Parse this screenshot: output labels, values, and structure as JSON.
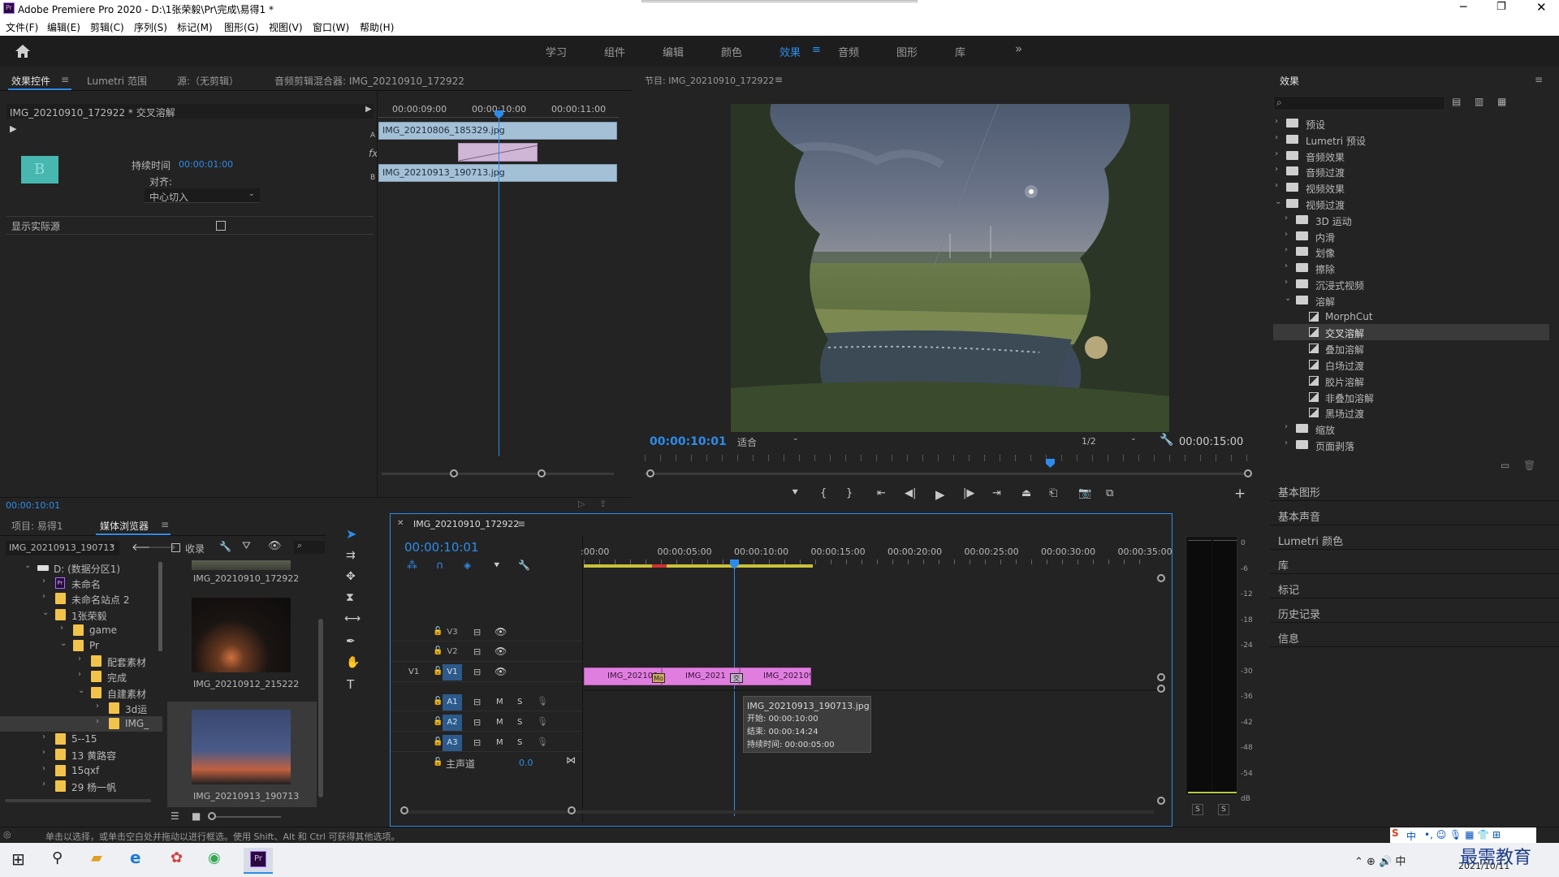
{
  "window": {
    "title": "Adobe Premiere Pro 2020 - D:\\1张荣毅\\Pr\\完成\\易得1 *"
  },
  "menu": [
    "文件(F)",
    "编辑(E)",
    "剪辑(C)",
    "序列(S)",
    "标记(M)",
    "图形(G)",
    "视图(V)",
    "窗口(W)",
    "帮助(H)"
  ],
  "workspaces": {
    "items": [
      "学习",
      "组件",
      "编辑",
      "颜色",
      "效果",
      "音频",
      "图形",
      "库"
    ],
    "active": "效果",
    "more": "»"
  },
  "effect_controls": {
    "tabs": [
      "效果控件",
      "Lumetri 范围",
      "源:（无剪辑）",
      "音频剪辑混合器: IMG_20210910_172922"
    ],
    "clip_title": "IMG_20210910_172922 * 交叉溶解",
    "duration_label": "持续时间",
    "duration_value": "00:00:01:00",
    "align_label": "对齐:",
    "align_value": "中心切入",
    "show_actual_label": "显示实际源",
    "ruler": [
      "00:00:09:00",
      "00:00:10:00",
      "00:00:11:00"
    ],
    "clip_a": "IMG_20210806_185329.jpg",
    "clip_b": "IMG_20210913_190713.jpg",
    "label_a": "A",
    "label_b": "B",
    "fx": "fx",
    "timecode": "00:00:10:01"
  },
  "program": {
    "title": "节目: IMG_20210910_172922",
    "timecode": "00:00:10:01",
    "fit": "适合",
    "quality": "1/2",
    "duration": "00:00:15:00"
  },
  "effects_panel": {
    "title": "效果",
    "search_placeholder": "",
    "tree": [
      {
        "label": "预设",
        "level": 0,
        "type": "folder",
        "open": false
      },
      {
        "label": "Lumetri 预设",
        "level": 0,
        "type": "folder",
        "open": false
      },
      {
        "label": "音频效果",
        "level": 0,
        "type": "folder",
        "open": false
      },
      {
        "label": "音频过渡",
        "level": 0,
        "type": "folder",
        "open": false
      },
      {
        "label": "视频效果",
        "level": 0,
        "type": "folder",
        "open": false
      },
      {
        "label": "视频过渡",
        "level": 0,
        "type": "folder",
        "open": true
      },
      {
        "label": "3D 运动",
        "level": 1,
        "type": "folder",
        "open": false
      },
      {
        "label": "内滑",
        "level": 1,
        "type": "folder",
        "open": false
      },
      {
        "label": "划像",
        "level": 1,
        "type": "folder",
        "open": false
      },
      {
        "label": "擦除",
        "level": 1,
        "type": "folder",
        "open": false
      },
      {
        "label": "沉浸式视频",
        "level": 1,
        "type": "folder",
        "open": false
      },
      {
        "label": "溶解",
        "level": 1,
        "type": "folder",
        "open": true
      },
      {
        "label": "MorphCut",
        "level": 2,
        "type": "effect"
      },
      {
        "label": "交叉溶解",
        "level": 2,
        "type": "effect",
        "selected": true
      },
      {
        "label": "叠加溶解",
        "level": 2,
        "type": "effect"
      },
      {
        "label": "白场过渡",
        "level": 2,
        "type": "effect"
      },
      {
        "label": "胶片溶解",
        "level": 2,
        "type": "effect"
      },
      {
        "label": "非叠加溶解",
        "level": 2,
        "type": "effect"
      },
      {
        "label": "黑场过渡",
        "level": 2,
        "type": "effect"
      },
      {
        "label": "缩放",
        "level": 1,
        "type": "folder",
        "open": false
      },
      {
        "label": "页面剥落",
        "level": 1,
        "type": "folder",
        "open": false
      }
    ],
    "collapsed_panels": [
      "基本图形",
      "基本声音",
      "Lumetri 颜色",
      "库",
      "标记",
      "历史记录",
      "信息"
    ]
  },
  "project": {
    "tabs": [
      "项目: 易得1",
      "媒体浏览器"
    ],
    "path_select": "IMG_20210913_190713",
    "favorite_label": "收录",
    "tree": [
      {
        "label": "D: (数据分区1)",
        "level": 0,
        "icon": "drive",
        "open": true
      },
      {
        "label": "未命名",
        "level": 1,
        "icon": "pr",
        "open": false
      },
      {
        "label": "未命名站点 2",
        "level": 1,
        "icon": "folder",
        "open": false
      },
      {
        "label": "1张荣毅",
        "level": 1,
        "icon": "folder",
        "open": true
      },
      {
        "label": "game",
        "level": 2,
        "icon": "folder",
        "open": false
      },
      {
        "label": "Pr",
        "level": 2,
        "icon": "folder",
        "open": true
      },
      {
        "label": "配套素材",
        "level": 3,
        "icon": "folder",
        "open": false
      },
      {
        "label": "完成",
        "level": 3,
        "icon": "folder",
        "open": false
      },
      {
        "label": "自建素材",
        "level": 3,
        "icon": "folder",
        "open": true
      },
      {
        "label": "3d运",
        "level": 4,
        "icon": "folder",
        "open": false
      },
      {
        "label": "IMG_",
        "level": 4,
        "icon": "folder",
        "open": false,
        "selected": true
      },
      {
        "label": "5--15",
        "level": 1,
        "icon": "folder",
        "open": false
      },
      {
        "label": "13 黄路容",
        "level": 1,
        "icon": "folder",
        "open": false
      },
      {
        "label": "15qxf",
        "level": 1,
        "icon": "folder",
        "open": false
      },
      {
        "label": "29 杨一帆",
        "level": 1,
        "icon": "folder",
        "open": false
      }
    ],
    "thumbs": [
      "IMG_20210910_172922",
      "IMG_20210912_215222",
      "IMG_20210913_190713"
    ]
  },
  "timeline": {
    "title": "IMG_20210910_172922",
    "timecode": "00:00:10:01",
    "ruler": [
      ":00:00",
      "00:00:05:00",
      "00:00:10:00",
      "00:00:15:00",
      "00:00:20:00",
      "00:00:25:00",
      "00:00:30:00",
      "00:00:35:00"
    ],
    "tracks_video": [
      "V3",
      "V2",
      "V1"
    ],
    "tracks_audio": [
      "A1",
      "A2",
      "A3"
    ],
    "source_patch": "V1",
    "mix_label": "主声道",
    "mix_value": "0.0",
    "m": "M",
    "s": "S",
    "clips": [
      "IMG_202109",
      "IMG_2021",
      "IMG_202109"
    ],
    "clip_fx": [
      "Mo",
      "交"
    ],
    "tooltip": {
      "name": "IMG_20210913_190713.jpg",
      "start": "开始: 00:00:10:00",
      "end": "结束: 00:00:14:24",
      "duration": "持续时间: 00:00:05:00"
    }
  },
  "meter": {
    "scale": [
      "0",
      "-6",
      "-12",
      "-18",
      "-24",
      "-30",
      "-36",
      "-42",
      "-48",
      "-54",
      "dB"
    ],
    "solo": [
      "S",
      "S"
    ]
  },
  "status_bar": {
    "text": "单击以选择，或单击空白处并拖动以进行框选。使用 Shift、Alt 和 Ctrl 可获得其他选项。"
  },
  "taskbar": {
    "date": "2021/10/11",
    "watermark": "最需教育",
    "ime": "中"
  },
  "colors": {
    "accent": "#2d8ceb",
    "clip": "#e07ee0",
    "panel": "#232323"
  }
}
